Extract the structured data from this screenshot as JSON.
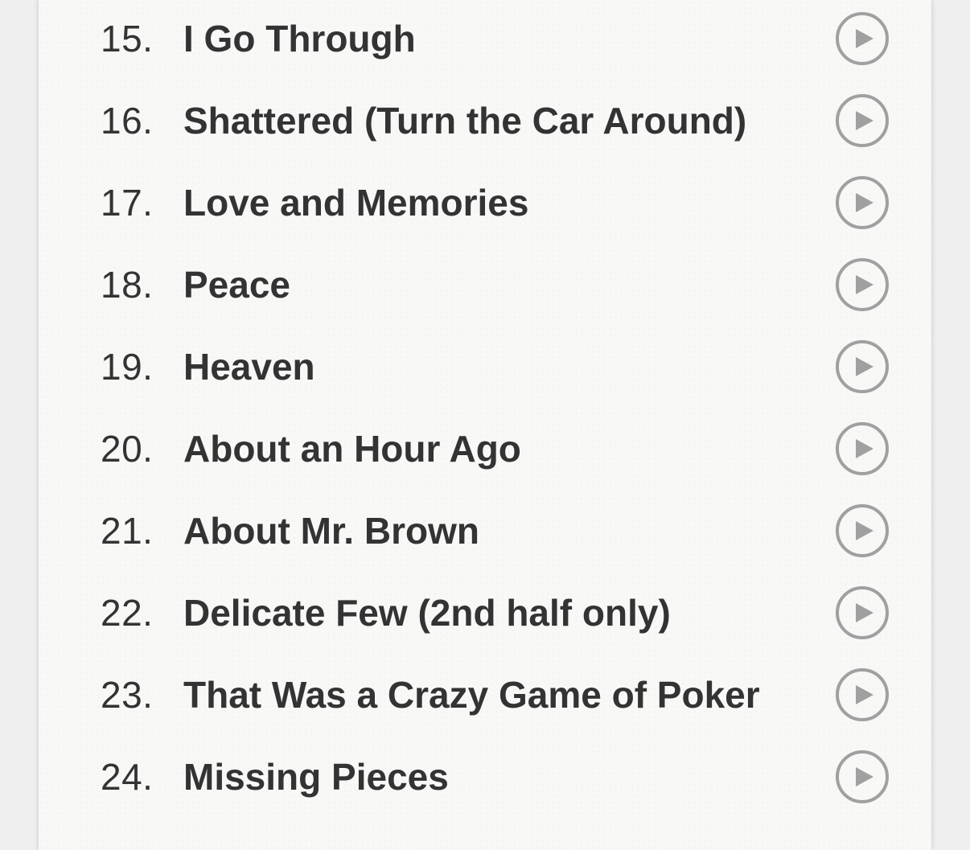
{
  "tracks": [
    {
      "number": "15.",
      "title": "I Go Through"
    },
    {
      "number": "16.",
      "title": "Shattered (Turn the Car Around)"
    },
    {
      "number": "17.",
      "title": "Love and Memories"
    },
    {
      "number": "18.",
      "title": "Peace"
    },
    {
      "number": "19.",
      "title": "Heaven"
    },
    {
      "number": "20.",
      "title": "About an Hour Ago"
    },
    {
      "number": "21.",
      "title": "About Mr. Brown"
    },
    {
      "number": "22.",
      "title": "Delicate Few (2nd half only)"
    },
    {
      "number": "23.",
      "title": "That Was a Crazy Game of Poker"
    },
    {
      "number": "24.",
      "title": "Missing Pieces"
    }
  ],
  "icons": {
    "play": "play-icon"
  },
  "colors": {
    "text": "#333333",
    "icon": "#a0a0a0",
    "card": "#f8f8f7"
  }
}
